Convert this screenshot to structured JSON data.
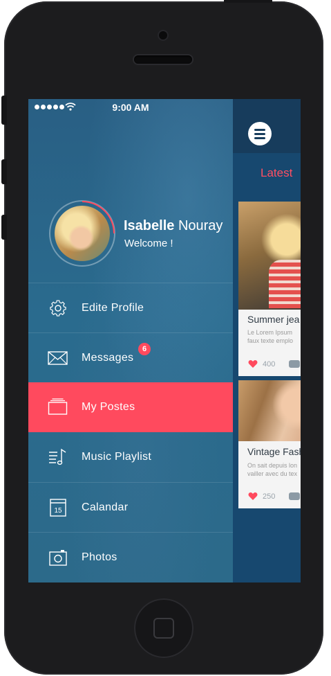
{
  "status_bar": {
    "time": "9:00 AM",
    "signal_icon": "signal-dots-icon",
    "wifi_icon": "wifi-icon"
  },
  "profile": {
    "first_name": "Isabelle",
    "last_name": "Nouray",
    "greeting": "Welcome !"
  },
  "menu": {
    "items": [
      {
        "label": "Edite Profile",
        "icon": "gear-icon"
      },
      {
        "label": "Messages",
        "icon": "envelope-icon",
        "badge": "6"
      },
      {
        "label": "My Postes",
        "icon": "stack-icon",
        "active": true
      },
      {
        "label": "Music Playlist",
        "icon": "music-list-icon"
      },
      {
        "label": "Calandar",
        "icon": "calendar-icon",
        "day": "15"
      },
      {
        "label": "Photos",
        "icon": "camera-icon"
      }
    ]
  },
  "content": {
    "menu_icon": "hamburger-icon",
    "tab_label": "Latest",
    "cards": [
      {
        "title": "Summer jea",
        "text_lines": [
          "Le Lorem Ipsum",
          "faux texte emplo"
        ],
        "likes": "400"
      },
      {
        "title": "Vintage Fash",
        "text_lines": [
          "On sait depuis lon",
          "vailler avec du tex"
        ],
        "likes": "250"
      }
    ]
  },
  "colors": {
    "accent": "#ff4a5e",
    "menu_bg": "#2a6b8e",
    "content_bg": "#17486f",
    "topbar": "#173c5c"
  }
}
